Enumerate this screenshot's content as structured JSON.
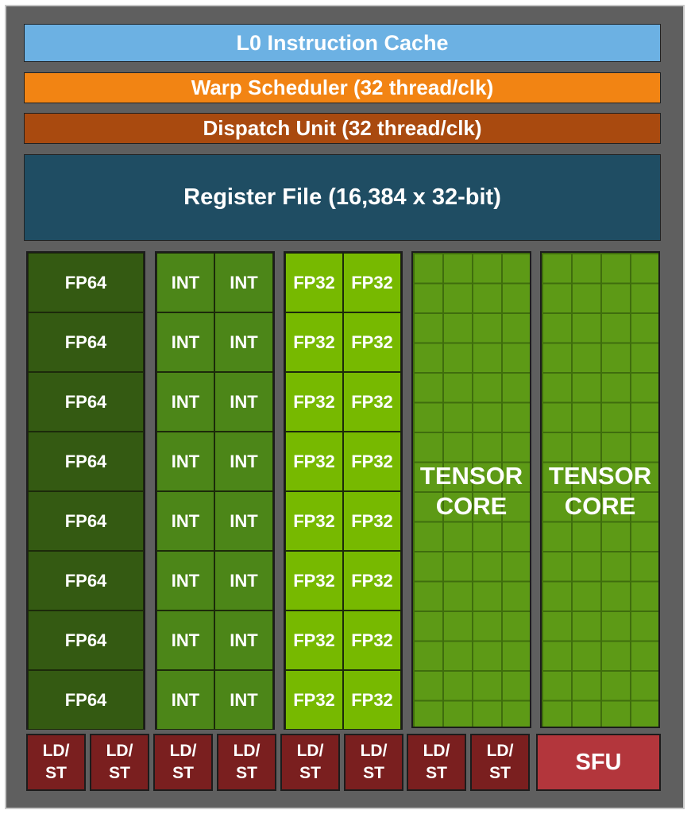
{
  "l0_cache": "L0 Instruction Cache",
  "warp_scheduler": "Warp Scheduler (32 thread/clk)",
  "dispatch_unit": "Dispatch Unit (32 thread/clk)",
  "register_file": "Register File (16,384 x 32-bit)",
  "fp64_label": "FP64",
  "int_label": "INT",
  "fp32_label": "FP32",
  "tensor_line1": "TENSOR",
  "tensor_line2": "CORE",
  "ldst_line1": "LD/",
  "ldst_line2": "ST",
  "sfu_label": "SFU",
  "rows": 8,
  "ldst_count": 8,
  "colors": {
    "l0": "#6cb1e3",
    "warp": "#f28413",
    "dispatch": "#a94a0f",
    "register_file": "#1f4d63",
    "fp64": "#345a12",
    "int": "#4c8618",
    "fp32": "#77b900",
    "tensor": "#5d9a16",
    "ldst": "#7a1f1f",
    "sfu": "#b3363c"
  }
}
